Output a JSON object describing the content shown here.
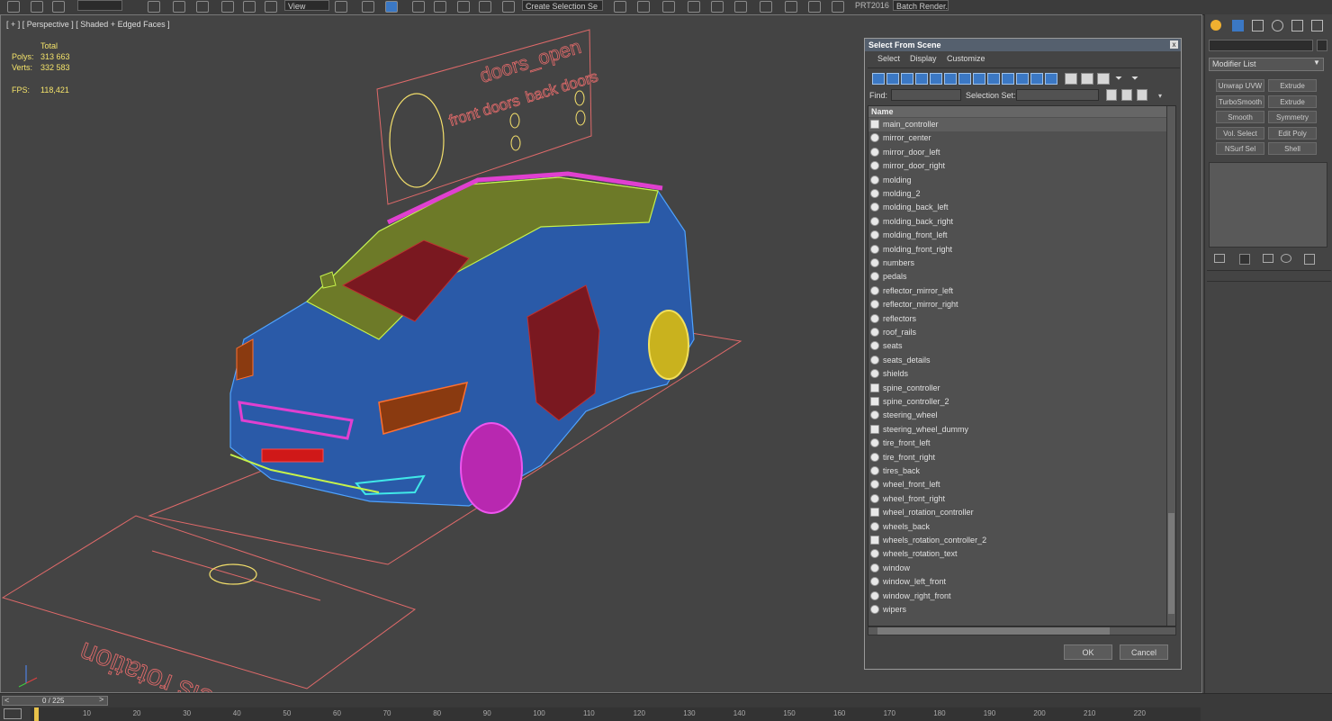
{
  "toolbar": {
    "view_combo": "View",
    "selection_combo": "Create Selection Se",
    "prt_label": "PRT2016",
    "batch_render": "Batch Render..."
  },
  "viewport": {
    "label": "[ + ] [ Perspective ] [ Shaded + Edged Faces ]",
    "stats": {
      "total_label": "Total",
      "polys_label": "Polys:",
      "polys_value": "313 663",
      "verts_label": "Verts:",
      "verts_value": "332 583",
      "fps_label": "FPS:",
      "fps_value": "118,421"
    },
    "scene_text": {
      "doors_open": "doors_open",
      "front_doors": "front doors",
      "back_doors": "back doors",
      "wheels_rotation": "wheels rotation"
    }
  },
  "command_panel": {
    "modifier_list": "Modifier List",
    "buttons": [
      "Unwrap UVW",
      "Extrude",
      "TurboSmooth",
      "Extrude",
      "Smooth",
      "Symmetry",
      "Vol. Select",
      "Edit Poly",
      "NSurf Sel",
      "Shell"
    ]
  },
  "dialog": {
    "title": "Select From Scene",
    "close": "x",
    "menu": [
      "Select",
      "Display",
      "Customize"
    ],
    "find_label": "Find:",
    "selection_set_label": "Selection Set:",
    "list_header": "Name",
    "items": [
      {
        "name": "main_controller",
        "type": "helper"
      },
      {
        "name": "mirror_center",
        "type": "object"
      },
      {
        "name": "mirror_door_left",
        "type": "object"
      },
      {
        "name": "mirror_door_right",
        "type": "object"
      },
      {
        "name": "molding",
        "type": "object"
      },
      {
        "name": "molding_2",
        "type": "object"
      },
      {
        "name": "molding_back_left",
        "type": "object"
      },
      {
        "name": "molding_back_right",
        "type": "object"
      },
      {
        "name": "molding_front_left",
        "type": "object"
      },
      {
        "name": "molding_front_right",
        "type": "object"
      },
      {
        "name": "numbers",
        "type": "object"
      },
      {
        "name": "pedals",
        "type": "object"
      },
      {
        "name": "reflector_mirror_left",
        "type": "object"
      },
      {
        "name": "reflector_mirror_right",
        "type": "object"
      },
      {
        "name": "reflectors",
        "type": "object"
      },
      {
        "name": "roof_rails",
        "type": "object"
      },
      {
        "name": "seats",
        "type": "object"
      },
      {
        "name": "seats_details",
        "type": "object"
      },
      {
        "name": "shields",
        "type": "object"
      },
      {
        "name": "spine_controller",
        "type": "helper"
      },
      {
        "name": "spine_controller_2",
        "type": "helper"
      },
      {
        "name": "steering_wheel",
        "type": "object"
      },
      {
        "name": "steering_wheel_dummy",
        "type": "helper"
      },
      {
        "name": "tire_front_left",
        "type": "object"
      },
      {
        "name": "tire_front_right",
        "type": "object"
      },
      {
        "name": "tires_back",
        "type": "object"
      },
      {
        "name": "wheel_front_left",
        "type": "object"
      },
      {
        "name": "wheel_front_right",
        "type": "object"
      },
      {
        "name": "wheel_rotation_controller",
        "type": "helper"
      },
      {
        "name": "wheels_back",
        "type": "object"
      },
      {
        "name": "wheels_rotation_controller_2",
        "type": "helper"
      },
      {
        "name": "wheels_rotation_text",
        "type": "object"
      },
      {
        "name": "window",
        "type": "object"
      },
      {
        "name": "window_left_front",
        "type": "object"
      },
      {
        "name": "window_right_front",
        "type": "object"
      },
      {
        "name": "wipers",
        "type": "object"
      }
    ],
    "ok": "OK",
    "cancel": "Cancel"
  },
  "timeline": {
    "frame_counter": "0 / 225",
    "ticks": [
      "10",
      "20",
      "30",
      "40",
      "50",
      "60",
      "70",
      "80",
      "90",
      "100",
      "110",
      "120",
      "130",
      "140",
      "150",
      "160",
      "170",
      "180",
      "190",
      "200",
      "210",
      "220"
    ]
  }
}
